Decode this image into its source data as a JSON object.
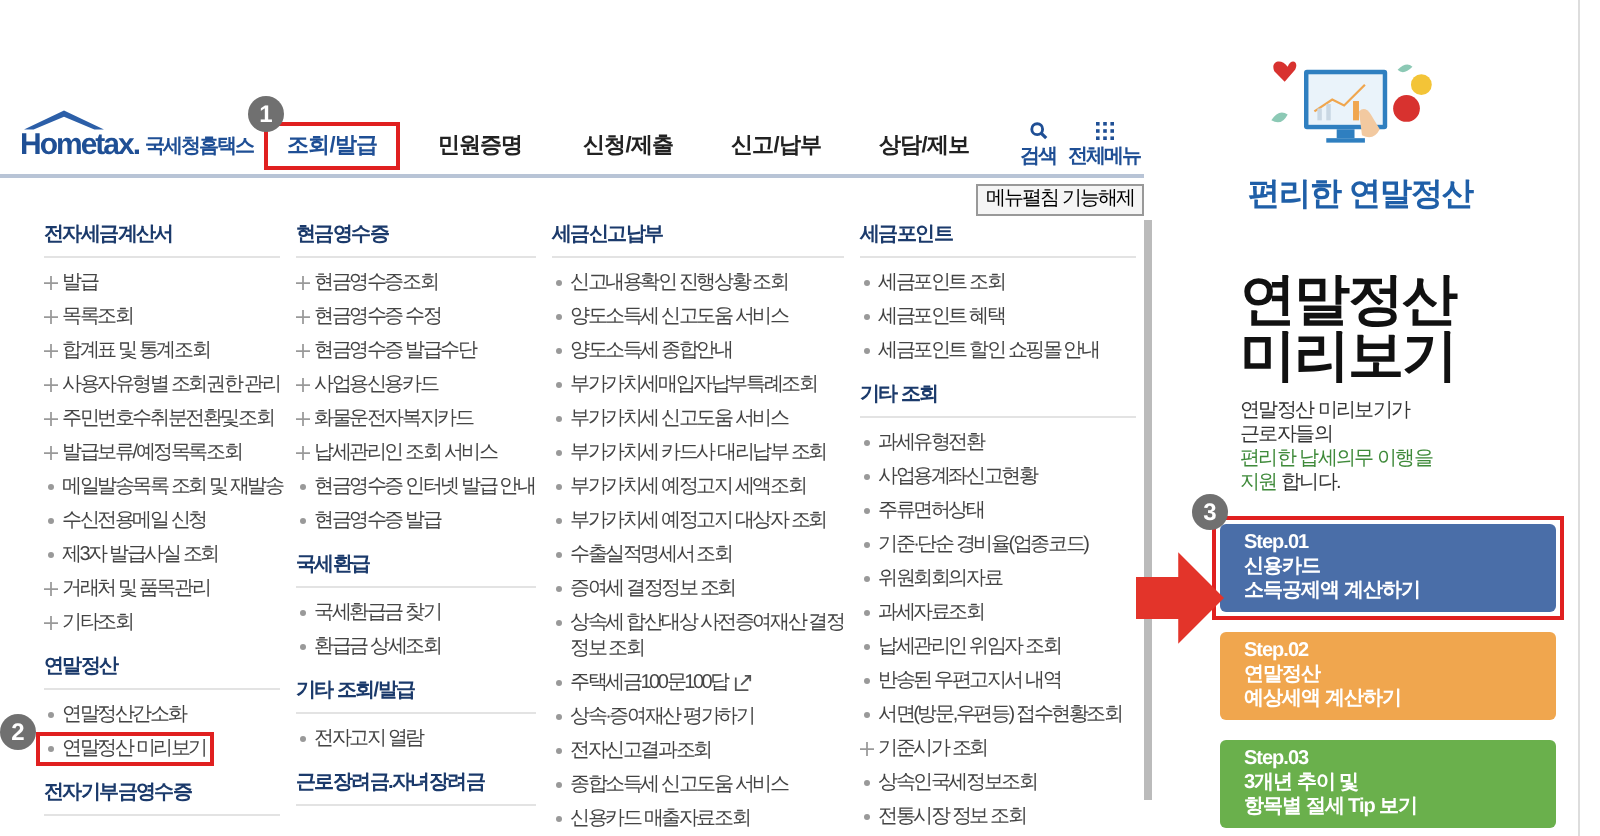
{
  "header": {
    "logo": {
      "wordmark": "Hometax.",
      "name": "국세청홈택스"
    },
    "nav": [
      {
        "label": "조회/발급",
        "selected": true,
        "highlighted": true,
        "badge": "1"
      },
      {
        "label": "민원증명",
        "selected": false,
        "highlighted": false
      },
      {
        "label": "신청/제출",
        "selected": false,
        "highlighted": false
      },
      {
        "label": "신고/납부",
        "selected": false,
        "highlighted": false
      },
      {
        "label": "상담/제보",
        "selected": false,
        "highlighted": false
      }
    ],
    "tools": [
      {
        "label": "검색",
        "kind": "search"
      },
      {
        "label": "전체메뉴",
        "kind": "grid"
      }
    ]
  },
  "menu_toggle_button": "메뉴펼침 기능해제",
  "columns": [
    {
      "sections": [
        {
          "title": "전자세금계산서",
          "items": [
            {
              "label": "발급",
              "kind": "plus",
              "highlighted": false
            },
            {
              "label": "목록조회",
              "kind": "plus",
              "highlighted": false
            },
            {
              "label": "합계표 및 통계조회",
              "kind": "plus",
              "highlighted": false
            },
            {
              "label": "사용자유형별 조회권한 관리",
              "kind": "plus",
              "highlighted": false
            },
            {
              "label": "주민번호수취분전환및조회",
              "kind": "plus",
              "highlighted": false
            },
            {
              "label": "발급보류/예정목록조회",
              "kind": "plus",
              "highlighted": false
            },
            {
              "label": "메일발송목록 조회 및 재발송",
              "kind": "dot",
              "highlighted": false
            },
            {
              "label": "수신전용메일 신청",
              "kind": "dot",
              "highlighted": false
            },
            {
              "label": "제3자 발급사실 조회",
              "kind": "dot",
              "highlighted": false
            },
            {
              "label": "거래처 및 품목관리",
              "kind": "plus",
              "highlighted": false
            },
            {
              "label": "기타조회",
              "kind": "plus",
              "highlighted": false
            }
          ]
        },
        {
          "title": "연말정산",
          "items": [
            {
              "label": "연말정산간소화",
              "kind": "dot",
              "highlighted": false
            },
            {
              "label": "연말정산 미리보기",
              "kind": "dot",
              "highlighted": true,
              "badge": "2"
            }
          ]
        },
        {
          "title": "전자기부금영수증"
        }
      ]
    },
    {
      "sections": [
        {
          "title": "현금영수증",
          "items": [
            {
              "label": "현금영수증조회",
              "kind": "plus",
              "highlighted": false
            },
            {
              "label": "현금영수증 수정",
              "kind": "plus",
              "highlighted": false
            },
            {
              "label": "현금영수증 발급수단",
              "kind": "plus",
              "highlighted": false
            },
            {
              "label": "사업용신용카드",
              "kind": "plus",
              "highlighted": false
            },
            {
              "label": "화물운전자복지카드",
              "kind": "plus",
              "highlighted": false
            },
            {
              "label": "납세관리인 조회 서비스",
              "kind": "plus",
              "highlighted": false
            },
            {
              "label": "현금영수증 인터넷 발급 안내",
              "kind": "dot",
              "highlighted": false
            },
            {
              "label": "현금영수증 발급",
              "kind": "dot",
              "highlighted": false
            }
          ]
        },
        {
          "title": "국세환급",
          "items": [
            {
              "label": "국세환급금 찾기",
              "kind": "dot",
              "highlighted": false
            },
            {
              "label": "환급금 상세조회",
              "kind": "dot",
              "highlighted": false
            }
          ]
        },
        {
          "title": "기타 조회/발급",
          "items": [
            {
              "label": "전자고지 열람",
              "kind": "dot",
              "highlighted": false
            }
          ]
        },
        {
          "title": "근로장려금.자녀장려금"
        }
      ]
    },
    {
      "sections": [
        {
          "title": "세금신고납부",
          "items": [
            {
              "label": "신고내용확인 진행상황 조회",
              "kind": "dot",
              "highlighted": false
            },
            {
              "label": "양도소득세 신고도움 서비스",
              "kind": "dot",
              "highlighted": false
            },
            {
              "label": "양도소득세 종합안내",
              "kind": "dot",
              "highlighted": false
            },
            {
              "label": "부가가치세매입자납부특례조회",
              "kind": "dot",
              "highlighted": false
            },
            {
              "label": "부가가치세 신고도움 서비스",
              "kind": "dot",
              "highlighted": false
            },
            {
              "label": "부가가치세 카드사 대리납부 조회",
              "kind": "dot",
              "highlighted": false
            },
            {
              "label": "부가가치세 예정고지 세액조회",
              "kind": "dot",
              "highlighted": false
            },
            {
              "label": "부가가치세 예정고지 대상자 조회",
              "kind": "dot",
              "highlighted": false
            },
            {
              "label": "수출실적명세서 조회",
              "kind": "dot",
              "highlighted": false
            },
            {
              "label": "증여세 결정정보 조회",
              "kind": "dot",
              "highlighted": false
            },
            {
              "label": "상속세 합산대상 사전증여재산 결정정보 조회",
              "kind": "dot",
              "highlighted": false
            },
            {
              "label": "주택세금100문100답",
              "kind": "link",
              "highlighted": false
            },
            {
              "label": "상속·증여재산 평가하기",
              "kind": "dot",
              "highlighted": false
            },
            {
              "label": "전자신고결과조회",
              "kind": "dot",
              "highlighted": false
            },
            {
              "label": "종합소득세 신고도움 서비스",
              "kind": "dot",
              "highlighted": false
            },
            {
              "label": "신용카드 매출자료조회",
              "kind": "dot",
              "highlighted": false
            }
          ]
        }
      ]
    },
    {
      "sections": [
        {
          "title": "세금포인트",
          "items": [
            {
              "label": "세금포인트 조회",
              "kind": "dot",
              "highlighted": false
            },
            {
              "label": "세금포인트 혜택",
              "kind": "dot",
              "highlighted": false
            },
            {
              "label": "세금포인트 할인 쇼핑몰 안내",
              "kind": "dot",
              "highlighted": false
            }
          ]
        },
        {
          "title": "기타 조회",
          "items": [
            {
              "label": "과세유형전환",
              "kind": "dot",
              "highlighted": false
            },
            {
              "label": "사업용계좌신고현황",
              "kind": "dot",
              "highlighted": false
            },
            {
              "label": "주류면허상태",
              "kind": "dot",
              "highlighted": false
            },
            {
              "label": "기준·단순 경비율(업종코드)",
              "kind": "dot",
              "highlighted": false
            },
            {
              "label": "위원회회의자료",
              "kind": "dot",
              "highlighted": false
            },
            {
              "label": "과세자료조회",
              "kind": "dot",
              "highlighted": false
            },
            {
              "label": "납세관리인 위임자 조회",
              "kind": "dot",
              "highlighted": false
            },
            {
              "label": "반송된 우편고지서 내역",
              "kind": "dot",
              "highlighted": false
            },
            {
              "label": "서면(방문,우편등) 접수현황조회",
              "kind": "dot",
              "highlighted": false
            },
            {
              "label": "기준시가 조회",
              "kind": "plus",
              "highlighted": false
            },
            {
              "label": "상속인국세정보조회",
              "kind": "dot",
              "highlighted": false
            },
            {
              "label": "전통시장 정보 조회",
              "kind": "dot",
              "highlighted": false
            }
          ]
        }
      ]
    }
  ],
  "promo": {
    "subtitle": "편리한 연말정산",
    "heading_lines": [
      "연말정산",
      "미리보기"
    ],
    "description_lines": [
      [
        {
          "text": "연말정산 미리보기가",
          "emphasis": false
        }
      ],
      [
        {
          "text": "근로자들의",
          "emphasis": false
        }
      ],
      [
        {
          "text": "편리한 납세의무 이행을",
          "emphasis": true
        }
      ],
      [
        {
          "text": "지원",
          "emphasis": true
        },
        {
          "text": " 합니다.",
          "emphasis": false
        }
      ]
    ],
    "steps": [
      {
        "step": "Step.01",
        "lines": [
          "신용카드",
          "소득공제액 계산하기"
        ],
        "color": "#4a6ea8",
        "highlighted": true,
        "badge": "3"
      },
      {
        "step": "Step.02",
        "lines": [
          "연말정산",
          "예상세액 계산하기"
        ],
        "color": "#f0a64e",
        "highlighted": false
      },
      {
        "step": "Step.03",
        "lines": [
          "3개년 추이 및",
          "항목별 절세 Tip 보기"
        ],
        "color": "#6ab04c",
        "highlighted": false
      }
    ]
  }
}
